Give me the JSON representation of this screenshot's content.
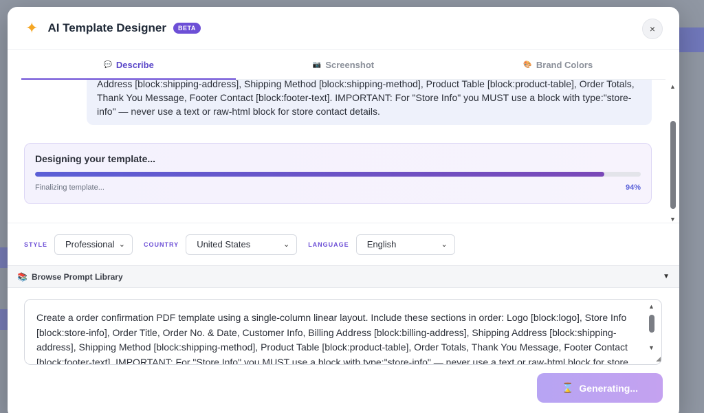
{
  "header": {
    "title": "AI Template Designer",
    "badge": "BETA",
    "close_glyph": "×"
  },
  "tabs": [
    {
      "label": "Describe",
      "icon": "speech-bubble-icon",
      "glyph": "💬",
      "active": true
    },
    {
      "label": "Screenshot",
      "icon": "camera-icon",
      "glyph": "📷",
      "active": false
    },
    {
      "label": "Brand Colors",
      "icon": "palette-icon",
      "glyph": "🎨",
      "active": false
    }
  ],
  "chat": {
    "message": "Address [block:shipping-address], Shipping Method [block:shipping-method], Product Table [block:product-table], Order Totals, Thank You Message, Footer Contact [block:footer-text]. IMPORTANT: For \"Store Info\" you MUST use a block with type:\"store-info\" — never use a text or raw-html block for store contact details."
  },
  "progress": {
    "title": "Designing your template...",
    "status": "Finalizing template...",
    "percent_label": "94%",
    "percent": 94,
    "colors": {
      "fill_start": "#5b5fd6",
      "fill_end": "#7a48b8"
    }
  },
  "options": {
    "style": {
      "label": "STYLE",
      "value": "Professional"
    },
    "country": {
      "label": "COUNTRY",
      "value": "United States"
    },
    "language": {
      "label": "LANGUAGE",
      "value": "English"
    }
  },
  "library": {
    "label": "Browse Prompt Library",
    "icon": "books-icon",
    "glyph": "📚",
    "toggle_glyph": "▼"
  },
  "prompt": {
    "value": "Create a order confirmation PDF template using a single-column linear layout. Include these sections in order: Logo [block:logo], Store Info [block:store-info], Order Title, Order No. & Date, Customer Info, Billing Address [block:billing-address], Shipping Address [block:shipping-address], Shipping Method [block:shipping-method], Product Table [block:product-table], Order Totals, Thank You Message, Footer Contact [block:footer-text]. IMPORTANT: For \"Store Info\" you MUST use a block with type:\"store-info\" — never use a text or raw-html block for store contact details."
  },
  "generate_button": {
    "label": "Generating...",
    "icon": "hourglass-icon",
    "glyph": "⌛"
  },
  "theme": {
    "accent": "#6d4fd6",
    "brand": "#5b48c9"
  }
}
